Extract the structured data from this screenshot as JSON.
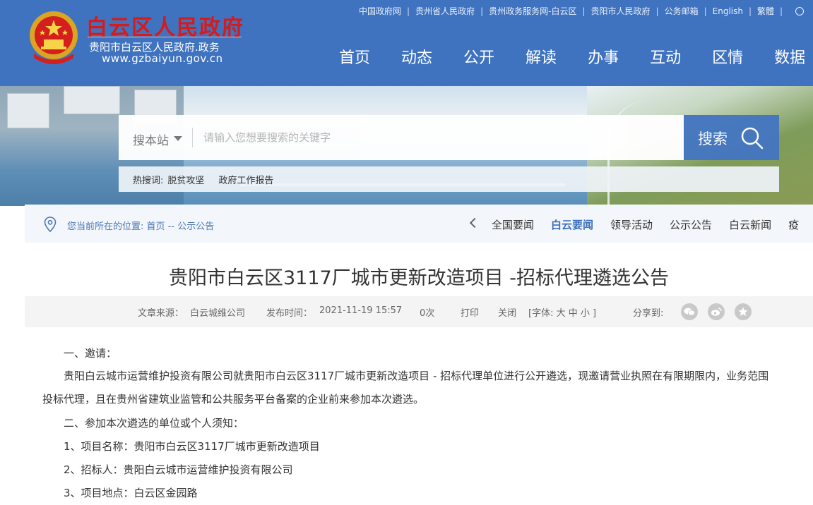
{
  "header": {
    "site_title": "白云区人民政府",
    "site_subtitle": "贵阳市白云区人民政府.政务",
    "site_url": "www.gzbaiyun.gov.cn",
    "top_links": [
      "中国政府网",
      "贵州省人民政府",
      "贵州政务服务网-白云区",
      "贵阳市人民政府",
      "公务邮箱",
      "English",
      "繁體"
    ],
    "nav": [
      "首页",
      "动态",
      "公开",
      "解读",
      "办事",
      "互动",
      "区情",
      "数据"
    ]
  },
  "search": {
    "scope_label": "搜本站",
    "placeholder": "请输入您想要搜索的关键字",
    "button_label": "搜索",
    "hot_label": "热搜词:",
    "hot_terms": [
      "脱贫攻坚",
      "政府工作报告"
    ]
  },
  "breadcrumb": {
    "prefix": "您当前所在的位置:",
    "home": "首页",
    "separator": "--",
    "current": "公示公告"
  },
  "subnav": {
    "items": [
      "全国要闻",
      "白云要闻",
      "领导活动",
      "公示公告",
      "白云新闻",
      "疫"
    ],
    "active_index": 1
  },
  "article": {
    "title": "贵阳市白云区3117厂城市更新改造项目 -招标代理遴选公告",
    "source_label": "文章来源：",
    "source": "白云城维公司",
    "publish_label": "发布时间：",
    "publish_time": "2021-11-19 15:57",
    "views": "0次",
    "print_label": "打印",
    "close_label": "关闭",
    "font_label": "[字体: 大 中 小 ]",
    "share_label": "分享到:",
    "share_icons": [
      "wechat-icon",
      "weibo-icon",
      "favorite-star-icon"
    ],
    "paragraphs": [
      "一、邀请：",
      "贵阳白云城市运营维护投资有限公司就贵阳市白云区3117厂城市更新改造项目 - 招标代理单位进行公开遴选，现邀请营业执照在有限期限内，业务范围",
      "投标代理，且在贵州省建筑业监管和公共服务平台备案的企业前来参加本次遴选。",
      "二、参加本次遴选的单位或个人须知：",
      "1、项目名称：贵阳市白云区3117厂城市更新改造项目",
      "2、招标人：贵阳白云城市运营维护投资有限公司",
      "3、项目地点：白云区金园路"
    ]
  },
  "colors": {
    "header_blue": "#3f73c0",
    "title_red": "#d71a1a",
    "accent_blue": "#3a6fc0"
  }
}
